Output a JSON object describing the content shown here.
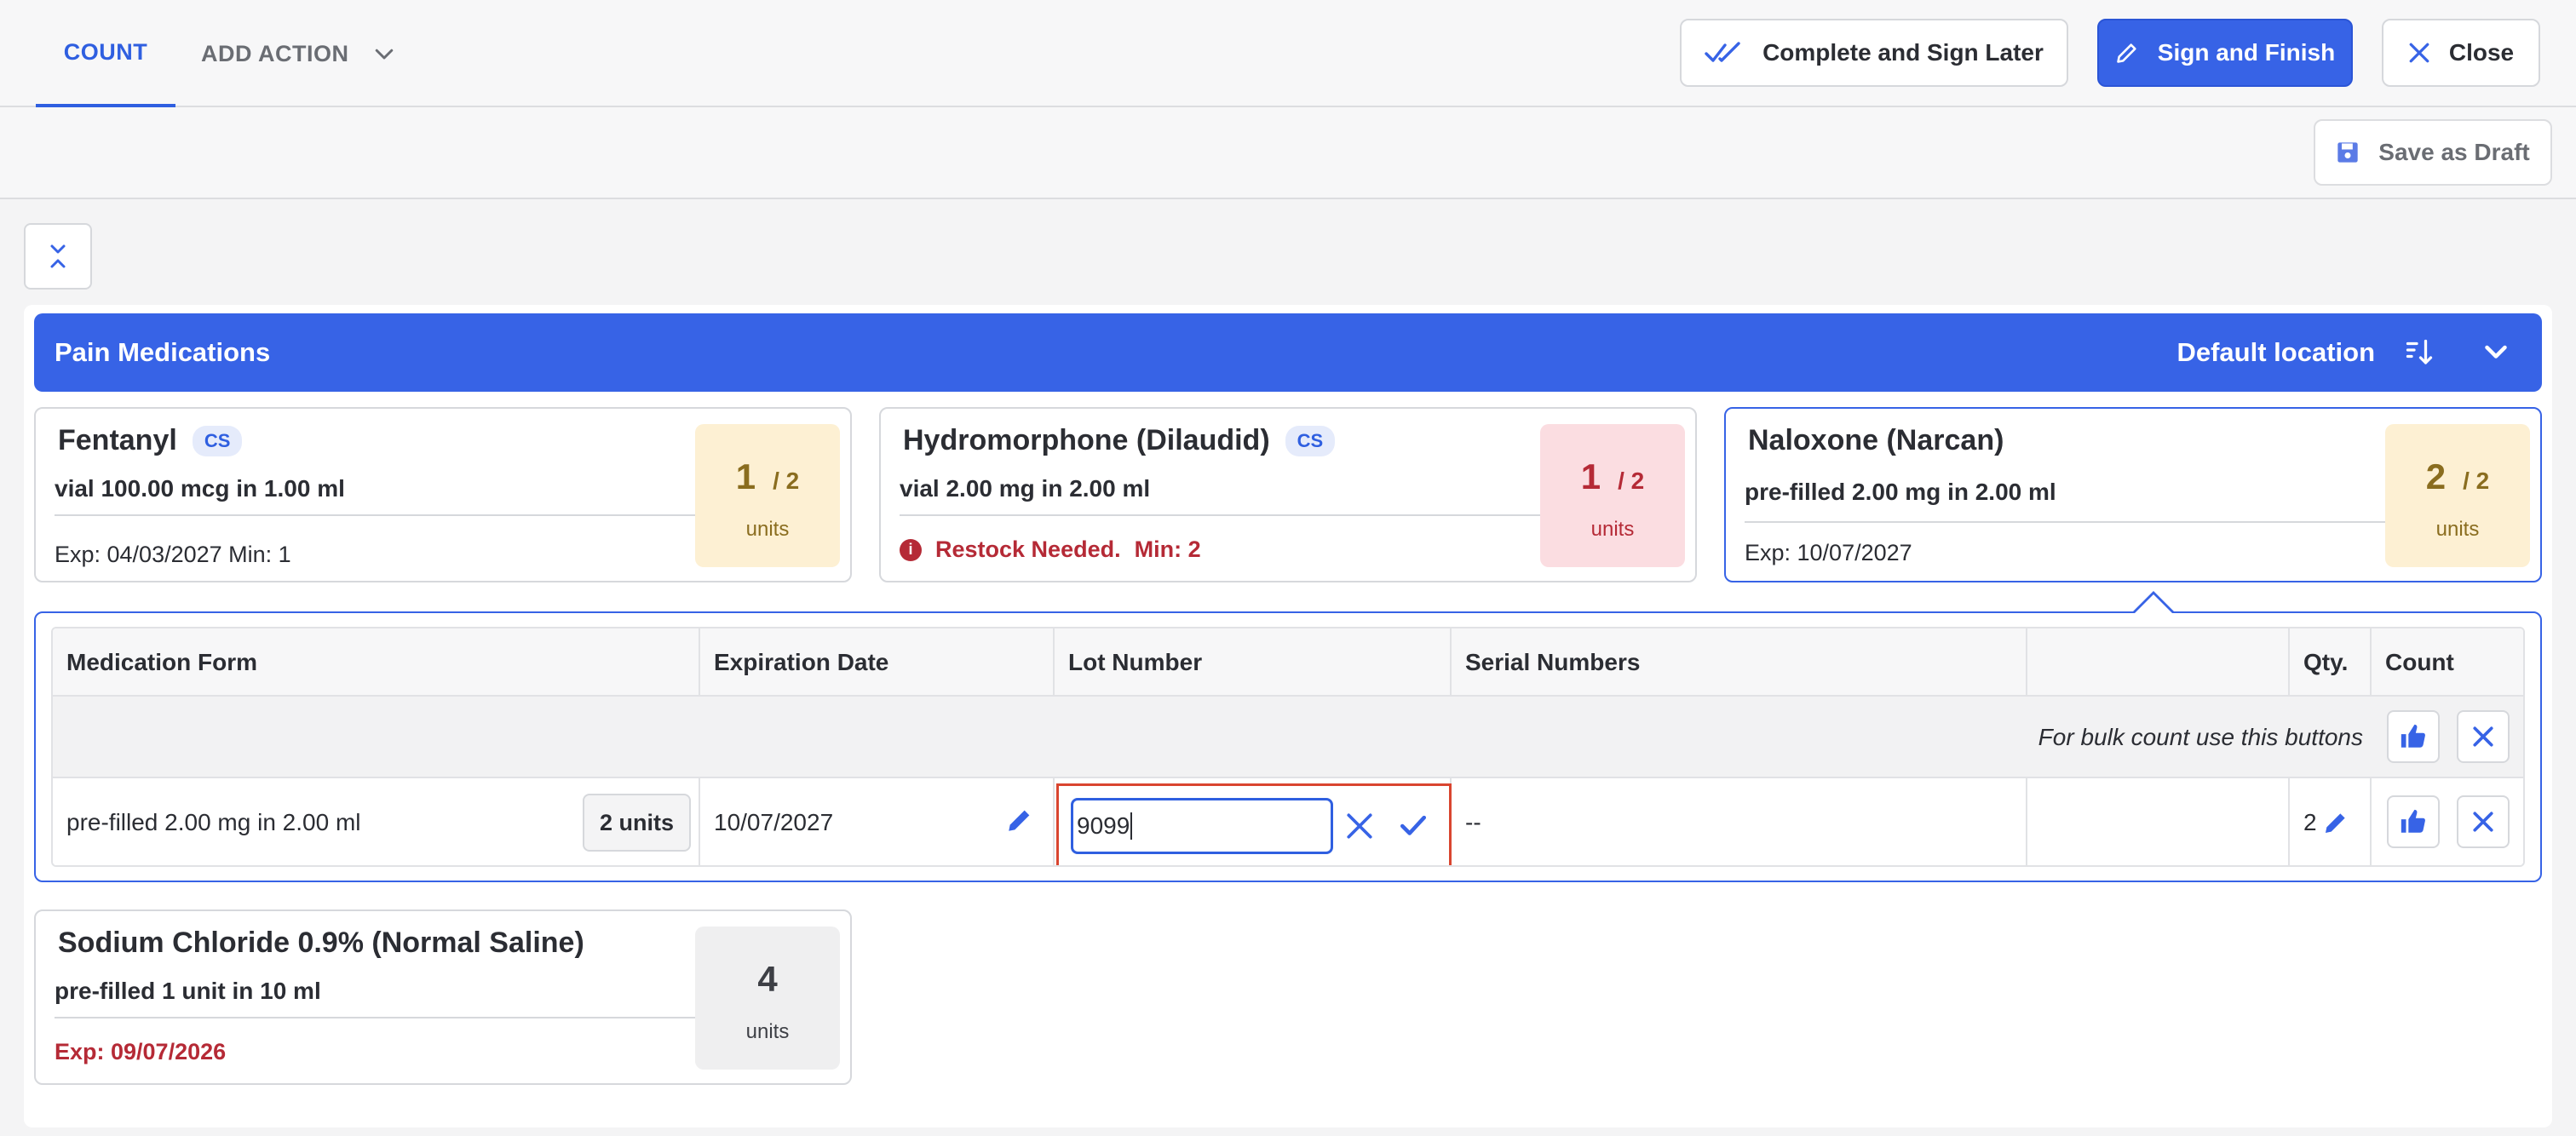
{
  "tabs": {
    "count": "COUNT",
    "add_action": "ADD ACTION"
  },
  "actions": {
    "complete_later": "Complete and Sign Later",
    "sign_finish": "Sign and Finish",
    "close": "Close",
    "save_draft": "Save as Draft"
  },
  "group": {
    "title": "Pain Medications",
    "location": "Default location"
  },
  "cards": [
    {
      "name": "Fentanyl",
      "badge": "CS",
      "form": "vial 100.00 mcg in 1.00 ml",
      "footer": "Exp: 04/03/2027 Min: 1",
      "count": "1",
      "total": "/ 2",
      "unit": "units"
    },
    {
      "name": "Hydromorphone (Dilaudid)",
      "badge": "CS",
      "form": "vial 2.00 mg in 2.00 ml",
      "footer_a": "Restock Needed.",
      "footer_b": "Min: 2",
      "count": "1",
      "total": "/ 2",
      "unit": "units"
    },
    {
      "name": "Naloxone (Narcan)",
      "form": "pre-filled 2.00 mg in 2.00 ml",
      "footer": "Exp: 10/07/2027",
      "count": "2",
      "total": "/ 2",
      "unit": "units"
    },
    {
      "name": "Sodium Chloride 0.9% (Normal Saline)",
      "form": "pre-filled 1 unit in 10 ml",
      "footer": "Exp: 09/07/2026",
      "count": "4",
      "unit": "units"
    }
  ],
  "table": {
    "headers": [
      "Medication Form",
      "Expiration Date",
      "Lot Number",
      "Serial Numbers",
      "",
      "Qty.",
      "Count"
    ],
    "bulk_hint": "For bulk count use this buttons",
    "row": {
      "form": "pre-filled 2.00 mg in 2.00 ml",
      "units": "2 units",
      "exp": "10/07/2027",
      "lot": "9099",
      "serial": "--",
      "qty": "2"
    }
  },
  "colors": {
    "accent": "#3763e6",
    "warning_bg": "#fdf0d3",
    "danger_bg": "#fbdde1",
    "danger": "#b52a36",
    "highlight_border": "#d9452f"
  },
  "icons": [
    "chevron-down-icon",
    "double-check-icon",
    "pencil-icon",
    "close-icon",
    "save-icon",
    "collapse-icon",
    "sort-icon",
    "info-icon",
    "thumbs-up-icon",
    "check-icon"
  ]
}
